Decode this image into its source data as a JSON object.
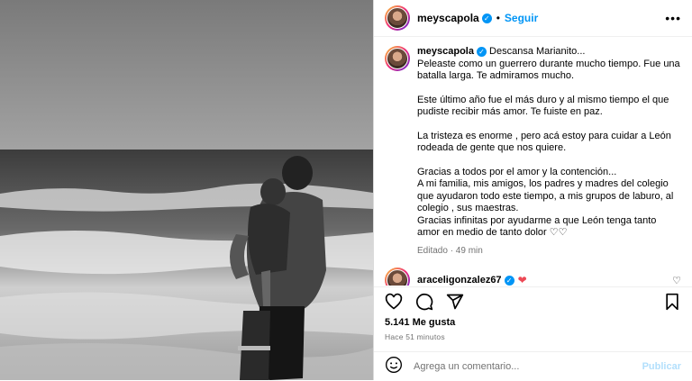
{
  "post": {
    "username": "meyscapola",
    "follow_label": "Seguir",
    "dot": "•",
    "more_icon": "more-horizontal-icon",
    "image_alt": "Black and white photo of a man holding a child at the sea"
  },
  "caption": {
    "username": "meyscapola",
    "paragraphs": [
      "Descansa Marianito...\nPeleaste como un guerrero durante mucho tiempo. Fue una batalla larga. Te admiramos mucho.",
      "Este último año fue el más duro y al mismo tiempo el que pudiste recibir más amor. Te fuiste en paz.",
      "La tristeza es enorme , pero acá estoy para cuidar a León rodeada de gente que nos quiere.",
      "Gracias a todos por el amor y la contención...\nA mi familia, mis amigos, los padres y madres del colegio que ayudaron todo este tiempo, a mis grupos de laburo, al colegio , sus maestras.\nGracias infinitas por ayudarme a que León tenga tanto amor en medio de tanto dolor ♡♡"
    ],
    "meta": "Editado · 49 min"
  },
  "comment": {
    "username": "araceligonzalez67",
    "heart": "❤"
  },
  "likes": "5.141 Me gusta",
  "timestamp": "Hace 51 minutos",
  "add_comment": {
    "placeholder": "Agrega un comentario...",
    "publish_label": "Publicar"
  },
  "colors": {
    "accent": "#0095f6",
    "publish_disabled": "#b2dffc",
    "muted": "#737373"
  }
}
